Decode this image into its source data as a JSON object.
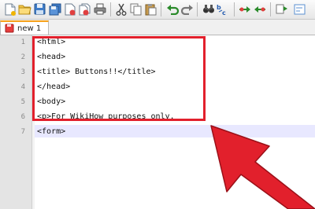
{
  "toolbar": {
    "buttons": [
      "new-file-icon",
      "open-folder-icon",
      "save-icon",
      "save-all-icon",
      "close-icon",
      "close-all-icon",
      "print-icon",
      "cut-icon",
      "copy-icon",
      "paste-icon",
      "undo-icon",
      "redo-icon",
      "find-icon",
      "replace-icon",
      "zoom-in-icon",
      "zoom-out-icon",
      "sync-scroll-icon"
    ]
  },
  "tab": {
    "label": "new  1",
    "icon": "unsaved-file-icon"
  },
  "editor": {
    "line_numbers": [
      "1",
      "2",
      "3",
      "4",
      "5",
      "6",
      "7"
    ],
    "lines": [
      "<html>",
      "<head>",
      "<title> Buttons!!</title>",
      "</head>",
      "<body>",
      "<p>For WikiHow purposes only.",
      "<form>"
    ],
    "current_line": 7
  },
  "annotation": {
    "box_color": "#e2202c",
    "arrow_color": "#e2202c",
    "arrow_icon": "pointer-arrow-icon"
  },
  "colors": {
    "tab_accent": "#f7a21c",
    "gutter_bg": "#e4e4e4",
    "current_line_bg": "#e8e8ff"
  }
}
